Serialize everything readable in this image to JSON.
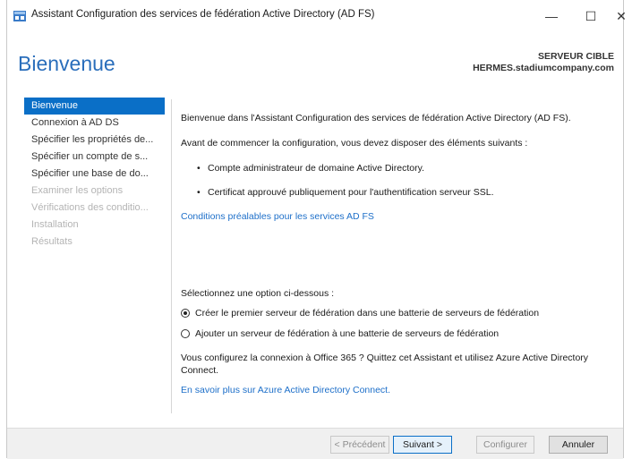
{
  "window": {
    "title": "Assistant Configuration des services de fédération Active Directory (AD FS)",
    "controls": {
      "minimize": "—",
      "maximize": "☐",
      "close": "✕"
    }
  },
  "header": {
    "title": "Bienvenue",
    "target_label": "SERVEUR CIBLE",
    "target_server": "HERMES.stadiumcompany.com"
  },
  "nav": {
    "items": [
      {
        "label": "Bienvenue",
        "state": "active"
      },
      {
        "label": "Connexion à AD DS",
        "state": "enabled"
      },
      {
        "label": "Spécifier les propriétés de...",
        "state": "enabled"
      },
      {
        "label": "Spécifier un compte de s...",
        "state": "enabled"
      },
      {
        "label": "Spécifier une base de do...",
        "state": "enabled"
      },
      {
        "label": "Examiner les options",
        "state": "disabled"
      },
      {
        "label": "Vérifications des conditio...",
        "state": "disabled"
      },
      {
        "label": "Installation",
        "state": "disabled"
      },
      {
        "label": "Résultats",
        "state": "disabled"
      }
    ]
  },
  "content": {
    "welcome": "Bienvenue dans l'Assistant Configuration des services de fédération Active Directory (AD FS).",
    "before_start": "Avant de commencer la configuration, vous devez disposer des éléments suivants :",
    "bullets": [
      "Compte administrateur de domaine Active Directory.",
      "Certificat approuvé publiquement pour l'authentification serveur SSL."
    ],
    "prereq_link": "Conditions préalables pour les services AD FS",
    "select_option": "Sélectionnez une option ci-dessous :",
    "options": [
      {
        "label": "Créer le premier serveur de fédération dans une batterie de serveurs de fédération",
        "checked": true
      },
      {
        "label": "Ajouter un serveur de fédération à une batterie de serveurs de fédération",
        "checked": false
      }
    ],
    "office_line1": "Vous configurez la connexion à Office 365 ? Quittez cet Assistant et utilisez Azure Active Directory",
    "office_line2": "Connect.",
    "azure_link": "En savoir plus sur Azure Active Directory Connect."
  },
  "footer": {
    "previous": "< Précédent",
    "next": "Suivant >",
    "configure": "Configurer",
    "cancel": "Annuler"
  },
  "colors": {
    "accent": "#0a6fc7",
    "title": "#2a6ebb",
    "link": "#1d6fc9",
    "disabled": "#b4b4b4"
  }
}
